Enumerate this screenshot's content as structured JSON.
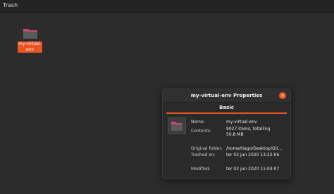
{
  "topbar": {
    "title": "Trash"
  },
  "desktop": {
    "item": {
      "name_line1": "my-virtual-",
      "name_line2": "env"
    }
  },
  "dialog": {
    "title": "my-virtual-env Properties",
    "close_symbol": "×",
    "tab": "Basic",
    "fields": {
      "name_label": "Name:",
      "name_value": "my-virtual-env",
      "contents_label": "Contents:",
      "contents_value_line1": "9027 items, totalling",
      "contents_value_line2": "50,8 MB",
      "original_folder_label": "Original folder:",
      "original_folder_value": "/home/tiago/Desktop/Git...",
      "trashed_on_label": "Trashed on:",
      "trashed_on_value": "ter 02 jun 2020 13:22:06",
      "modified_label": "Modified:",
      "modified_value": "ter 02 jun 2020 11:03:07"
    }
  },
  "colors": {
    "accent": "#e95420",
    "background": "#2c2c2c",
    "dialog_bg": "#2a2a2a",
    "folder_body": "#6a6a6a",
    "folder_tab": "#c34a6a"
  },
  "icons": {
    "folder": "folder-icon",
    "close": "close-icon"
  }
}
